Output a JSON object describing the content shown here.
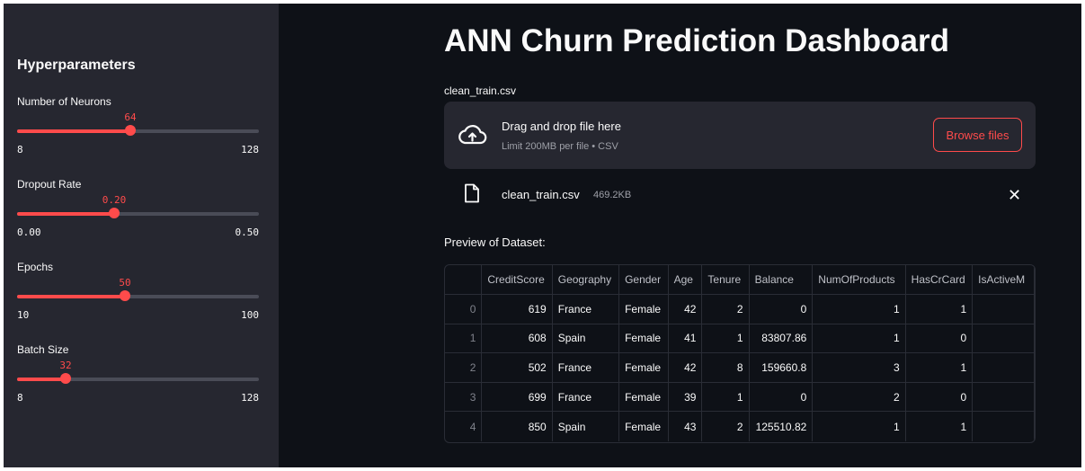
{
  "sidebar": {
    "title": "Hyperparameters",
    "sliders": [
      {
        "label": "Number of Neurons",
        "value": "64",
        "min": "8",
        "max": "128",
        "fraction": 0.4667
      },
      {
        "label": "Dropout Rate",
        "value": "0.20",
        "min": "0.00",
        "max": "0.50",
        "fraction": 0.4
      },
      {
        "label": "Epochs",
        "value": "50",
        "min": "10",
        "max": "100",
        "fraction": 0.4444
      },
      {
        "label": "Batch Size",
        "value": "32",
        "min": "8",
        "max": "128",
        "fraction": 0.2
      }
    ]
  },
  "main": {
    "title": "ANN Churn Prediction Dashboard",
    "uploader": {
      "label": "clean_train.csv",
      "drag_text": "Drag and drop file here",
      "limit_text": "Limit 200MB per file • CSV",
      "browse_label": "Browse files"
    },
    "file": {
      "name": "clean_train.csv",
      "size": "469.2KB"
    },
    "preview_label": "Preview of Dataset:",
    "table": {
      "columns": [
        "",
        "CreditScore",
        "Geography",
        "Gender",
        "Age",
        "Tenure",
        "Balance",
        "NumOfProducts",
        "HasCrCard",
        "IsActiveM"
      ],
      "rows": [
        [
          "0",
          "619",
          "France",
          "Female",
          "42",
          "2",
          "0",
          "1",
          "1",
          ""
        ],
        [
          "1",
          "608",
          "Spain",
          "Female",
          "41",
          "1",
          "83807.86",
          "1",
          "0",
          ""
        ],
        [
          "2",
          "502",
          "France",
          "Female",
          "42",
          "8",
          "159660.8",
          "3",
          "1",
          ""
        ],
        [
          "3",
          "699",
          "France",
          "Female",
          "39",
          "1",
          "0",
          "2",
          "0",
          ""
        ],
        [
          "4",
          "850",
          "Spain",
          "Female",
          "43",
          "2",
          "125510.82",
          "1",
          "1",
          ""
        ]
      ]
    }
  },
  "colors": {
    "accent": "#ff4b4b",
    "sidebar_bg": "#262730",
    "main_bg": "#0e1117"
  },
  "icons": {
    "upload": "cloud-upload-icon",
    "file": "file-icon",
    "close": "close-icon"
  }
}
